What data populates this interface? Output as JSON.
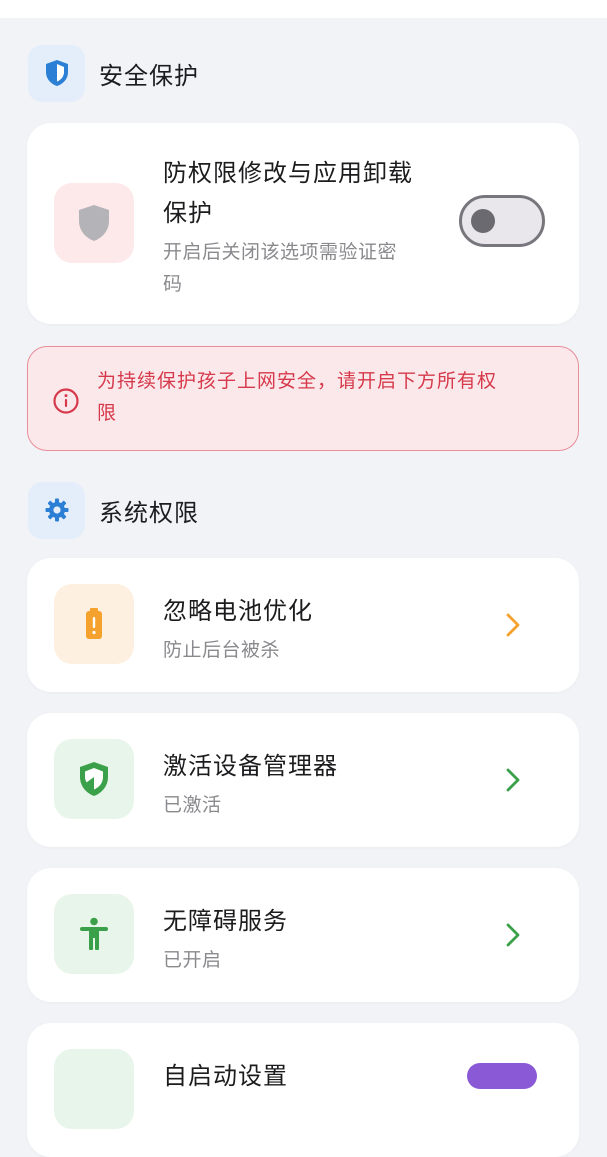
{
  "security_section": {
    "title": "安全保护",
    "icon": "shield-icon",
    "card": {
      "title_line1": "防权限修改与应用卸载",
      "title_line2": "保护",
      "subtitle_line1": "开启后关闭该选项需验证密",
      "subtitle_line2": "码",
      "toggle_state": "off"
    }
  },
  "warning": {
    "line1": "为持续保护孩子上网安全，请开启下方所有权",
    "line2": "限"
  },
  "system_section": {
    "title": "系统权限",
    "icon": "gear-icon",
    "items": [
      {
        "title": "忽略电池优化",
        "subtitle": "防止后台被杀",
        "icon": "battery-alert-icon",
        "accent": "#f5a12d"
      },
      {
        "title": "激活设备管理器",
        "subtitle": "已激活",
        "icon": "shield-check-icon",
        "accent": "#3aa14a"
      },
      {
        "title": "无障碍服务",
        "subtitle": "已开启",
        "icon": "accessibility-icon",
        "accent": "#3aa14a"
      },
      {
        "title": "自启动设置",
        "subtitle": "",
        "icon": "autostart-icon",
        "accent": "#3aa14a"
      }
    ]
  },
  "colors": {
    "background": "#f1f3f7",
    "card": "#ffffff",
    "warning_text": "#d6394b",
    "warning_bg": "#fbe8ea",
    "section_icon": "#2b7fd4"
  }
}
